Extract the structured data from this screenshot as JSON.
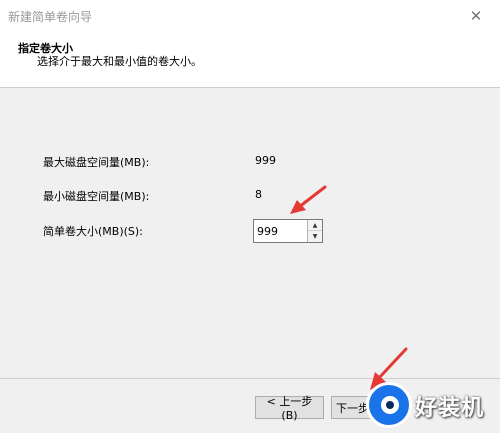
{
  "window": {
    "title": "新建简单卷向导"
  },
  "header": {
    "title": "指定卷大小",
    "subtitle": "选择介于最大和最小值的卷大小。"
  },
  "fields": {
    "max_label": "最大磁盘空间量(MB):",
    "max_value": "999",
    "min_label": "最小磁盘空间量(MB):",
    "min_value": "8",
    "size_label": "简单卷大小(MB)(S):",
    "size_value": "999"
  },
  "buttons": {
    "back": "< 上一步(B)",
    "next": "下一步"
  },
  "watermark": {
    "text": "好装机"
  },
  "icons": {
    "close": "close-icon",
    "spin_up": "spin-up-icon",
    "spin_down": "spin-down-icon"
  },
  "colors": {
    "annotation_arrow": "#e53935",
    "watermark_blue": "#1a73e8"
  }
}
